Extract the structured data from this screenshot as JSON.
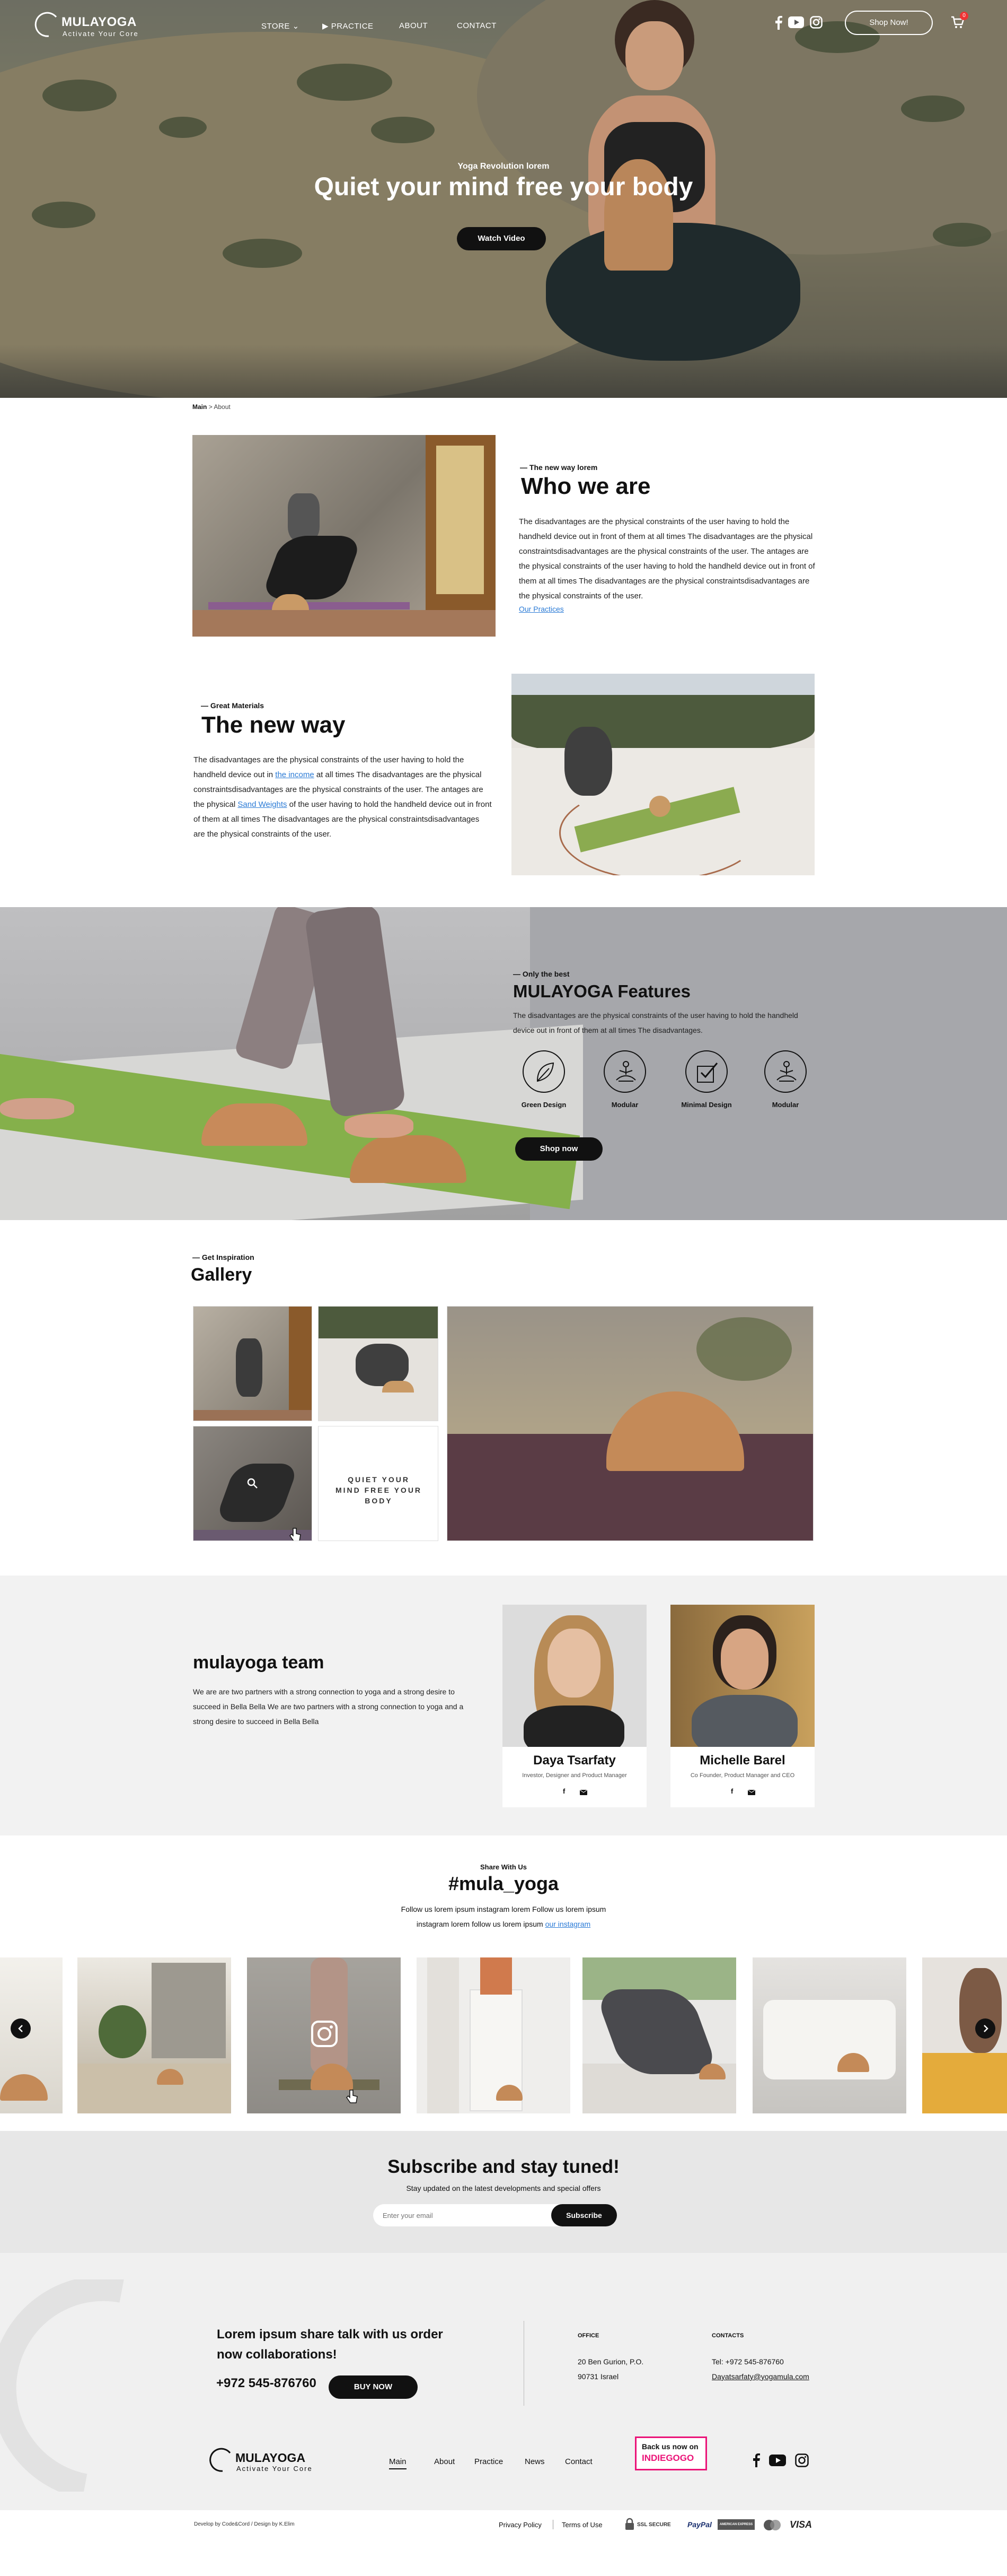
{
  "brand": {
    "name": "MULAYOGA",
    "tagline": "Activate Your Core"
  },
  "nav": {
    "store": "STORE",
    "practice": "PRACTICE",
    "about": "ABOUT",
    "contact": "CONTACT",
    "shop_now": "Shop Now!",
    "cart_count": "0"
  },
  "hero": {
    "eyebrow": "Yoga Revolution lorem",
    "title": "Quiet your mind free your body",
    "button": "Watch Video"
  },
  "breadcrumb": {
    "main": "Main",
    "separator": ">",
    "current": "About"
  },
  "who": {
    "eyebrow": "— The new way lorem",
    "title": "Who we are",
    "body": "The disadvantages are the physical constraints of the user having to hold the handheld device out in front of them at all times The disadvantages are the physical constraintsdisadvantages are the physical constraints of the user. The antages are the physical constraints of the user having to hold the handheld device out in front of them at all times The disadvantages are the physical constraintsdisadvantages are the physical constraints of the user.",
    "link": "Our Practices"
  },
  "newway": {
    "eyebrow": "— Great Materials",
    "title": "The new way",
    "p1": "The disadvantages are the physical constraints of the user having to hold the handheld device out in ",
    "link1": "the income",
    "p2": " at all times The disadvantages are the physical constraintsdisadvantages are the physical constraints of the user.  The  antages are the physical ",
    "link2": "Sand Weights",
    "p3": " of the user having to hold the handheld device out in front of them at all times The disadvantages are the physical constraintsdisadvantages are the physical constraints of the user."
  },
  "features": {
    "eyebrow": "— Only the best",
    "title": "MULAYOGA Features",
    "body": "The disadvantages are the physical constraints of the user having to hold the handheld device out in front of them at all times The disadvantages.",
    "items": [
      {
        "label": "Green Design",
        "icon": "leaf-icon"
      },
      {
        "label": "Modular",
        "icon": "meditation-icon"
      },
      {
        "label": "Minimal Design",
        "icon": "check-icon"
      },
      {
        "label": "Modular",
        "icon": "meditation-icon"
      }
    ],
    "button": "Shop now"
  },
  "gallery": {
    "eyebrow": "— Get Inspiration",
    "title": "Gallery",
    "tile_text": "QUIET YOUR MIND FREE YOUR BODY"
  },
  "team": {
    "title": "mulayoga team",
    "body": "We are are two partners with a strong connection to yoga and a strong desire to succeed in Bella Bella We are two partners with a strong connection to yoga and a strong desire to succeed in Bella Bella",
    "members": [
      {
        "name": "Daya Tsarfaty",
        "role": "Investor, Designer and Product Manager"
      },
      {
        "name": "Michelle Barel",
        "role": "Co Founder, Product Manager and CEO"
      }
    ]
  },
  "share": {
    "eyebrow": "Share With Us",
    "hashtag": "#mula_yoga",
    "line1": "Follow us lorem ipsum instagram lorem Follow us lorem ipsum",
    "line2a": "instagram lorem follow us lorem ipsum ",
    "line2_link": "our instagram"
  },
  "subscribe": {
    "title": "Subscribe and stay tuned!",
    "subtitle": "Stay updated on the latest developments and special offers",
    "placeholder": "Enter your email",
    "button": "Subscribe"
  },
  "footer": {
    "cta_line1": "Lorem ipsum share talk with us order",
    "cta_line2": "now collaborations!",
    "phone": "+972 545-876760",
    "buy_now": "BUY NOW",
    "office_label": "OFFICE",
    "office_line1": "20 Ben Gurion, P.O.",
    "office_line2": "90731 Israel",
    "contacts_label": "CONTACTS",
    "tel": "Tel: +972 545-876760",
    "email": "Dayatsarfaty@yogamula.com",
    "nav": [
      "Main",
      "About",
      "Practice",
      "News",
      "Contact"
    ],
    "indiegogo_line1": "Back us now on",
    "indiegogo_line2": "INDIEGOGO",
    "credits": "Develop by Code&Cord / Design by K.Elim",
    "privacy": "Privacy Policy",
    "terms": "Terms of Use",
    "ssl": "SSL SECURE",
    "paypal": "PayPal",
    "amex": "AMERICAN EXPRESS",
    "visa": "VISA"
  },
  "colors": {
    "accent_link": "#2b7bd6",
    "indiegogo": "#eb1478",
    "dark": "#111111",
    "features_bg": "#a6a7ab",
    "light_section": "#f2f2f2"
  }
}
